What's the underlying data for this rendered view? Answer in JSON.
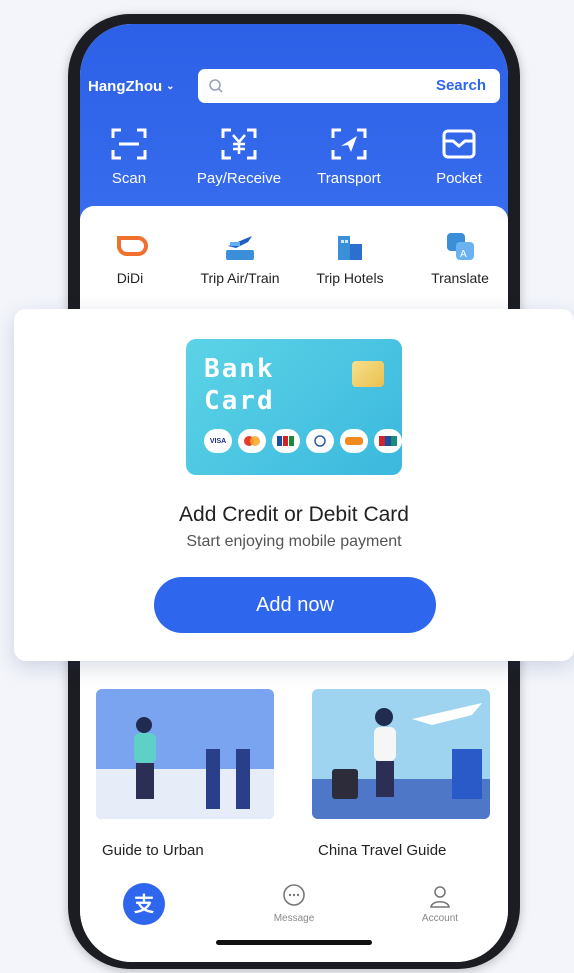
{
  "header": {
    "city": "HangZhou",
    "search_placeholder": "",
    "search_button": "Search"
  },
  "top_actions": [
    {
      "label": "Scan",
      "icon": "scan-icon"
    },
    {
      "label": "Pay/Receive",
      "icon": "yuan-icon"
    },
    {
      "label": "Transport",
      "icon": "transport-icon"
    },
    {
      "label": "Pocket",
      "icon": "wallet-icon"
    }
  ],
  "services": [
    {
      "label": "DiDi",
      "icon": "didi-icon"
    },
    {
      "label": "Trip Air/Train",
      "icon": "plane-icon"
    },
    {
      "label": "Trip Hotels",
      "icon": "hotel-icon"
    },
    {
      "label": "Translate",
      "icon": "translate-icon"
    }
  ],
  "promo": {
    "card_text_line1": "Bank",
    "card_text_line2": "Card",
    "title": "Add Credit or Debit Card",
    "subtitle": "Start enjoying mobile payment",
    "button": "Add now"
  },
  "guides": [
    {
      "label": "Guide to Urban"
    },
    {
      "label": "China Travel Guide"
    }
  ],
  "tabbar": [
    {
      "label": "",
      "icon": "alipay-icon"
    },
    {
      "label": "Message",
      "icon": "message-icon"
    },
    {
      "label": "Account",
      "icon": "user-icon"
    }
  ],
  "colors": {
    "primary": "#2f66ee",
    "card": "#4cc6e2"
  }
}
